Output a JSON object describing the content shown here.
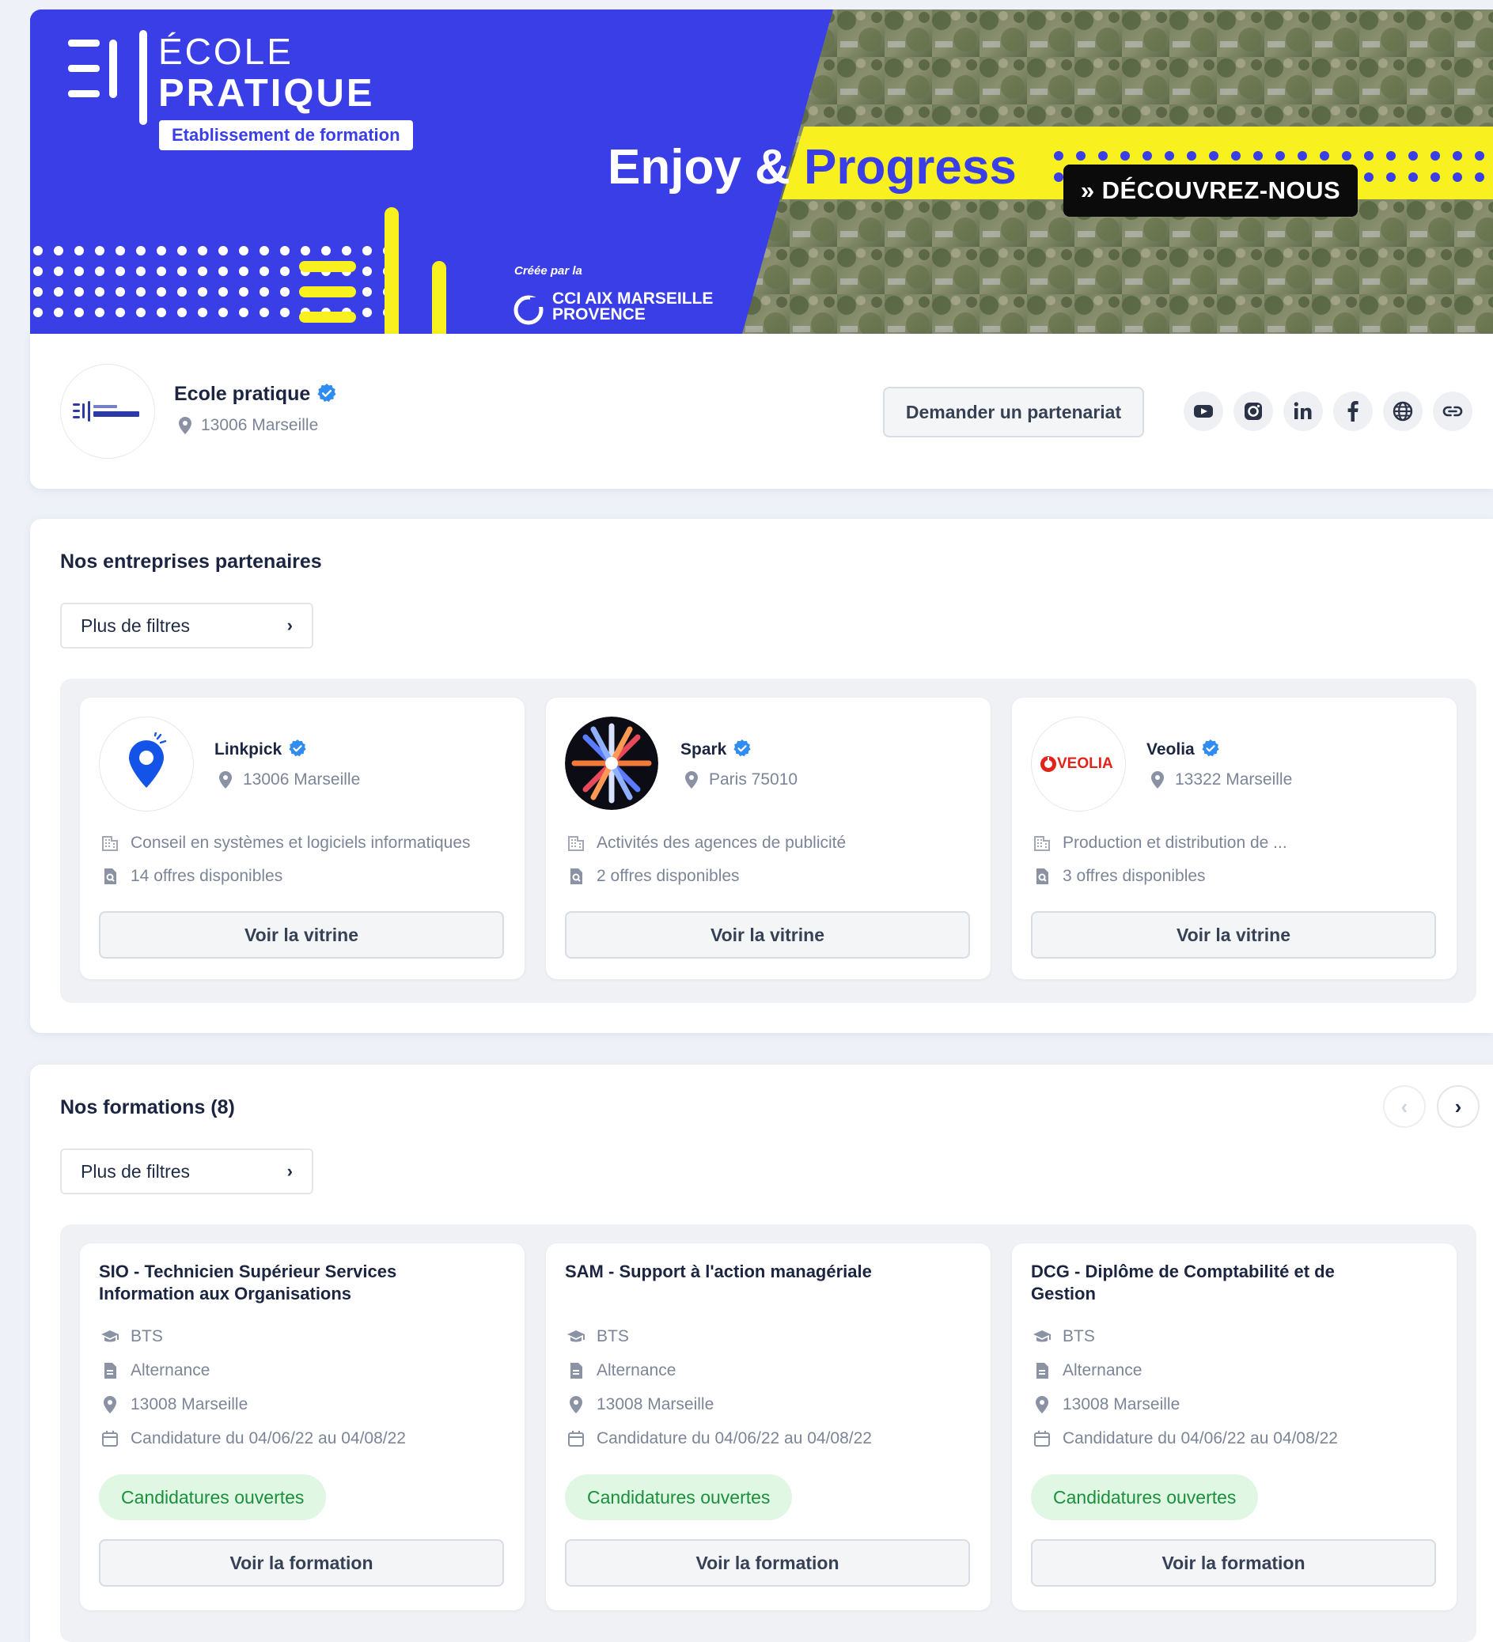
{
  "banner": {
    "logo_line1": "ÉCOLE",
    "logo_line2": "PRATIQUE",
    "logo_badge": "Etablissement de formation",
    "slogan_part1": "Enjoy &",
    "slogan_part2": "Progress",
    "created_by": "Créée par la",
    "cci_line1": "CCI AIX MARSEILLE",
    "cci_line2": "PROVENCE",
    "discover_label": "» DÉCOUVREZ-NOUS",
    "colors": {
      "primary_blue": "#3a3ee6",
      "accent_yellow": "#f9f020"
    }
  },
  "profile": {
    "name": "Ecole pratique",
    "location": "13006 Marseille",
    "partner_button": "Demander un partenariat",
    "social_icons": [
      "youtube-icon",
      "instagram-icon",
      "linkedin-icon",
      "facebook-icon",
      "globe-icon",
      "link-icon"
    ]
  },
  "partners": {
    "title": "Nos entreprises partenaires",
    "filter_label": "Plus de filtres",
    "items": [
      {
        "name": "Linkpick",
        "location": "13006 Marseille",
        "sector": "Conseil en systèmes et logiciels informatiques",
        "offers": "14 offres disponibles",
        "button": "Voir la vitrine"
      },
      {
        "name": "Spark",
        "location": "Paris 75010",
        "sector": "Activités des agences de publicité",
        "offers": "2 offres disponibles",
        "button": "Voir la vitrine"
      },
      {
        "name": "Veolia",
        "location": "13322 Marseille",
        "sector": "Production et distribution de ...",
        "offers": "3 offres disponibles",
        "button": "Voir la vitrine",
        "logo_text": "VEOLIA"
      }
    ]
  },
  "formations": {
    "title": "Nos formations (8)",
    "filter_label": "Plus de filtres",
    "items": [
      {
        "title": "SIO - Technicien Supérieur Services Information aux Organisations",
        "level": "BTS",
        "type": "Alternance",
        "location": "13008 Marseille",
        "dates": "Candidature du 04/06/22 au 04/08/22",
        "status": "Candidatures ouvertes",
        "button": "Voir la formation"
      },
      {
        "title": "SAM - Support à l'action managériale",
        "level": "BTS",
        "type": "Alternance",
        "location": "13008 Marseille",
        "dates": "Candidature du 04/06/22 au 04/08/22",
        "status": "Candidatures ouvertes",
        "button": "Voir la formation"
      },
      {
        "title": "DCG - Diplôme de Comptabilité et de Gestion",
        "level": "BTS",
        "type": "Alternance",
        "location": "13008 Marseille",
        "dates": "Candidature du 04/06/22 au 04/08/22",
        "status": "Candidatures ouvertes",
        "button": "Voir la formation"
      }
    ]
  }
}
